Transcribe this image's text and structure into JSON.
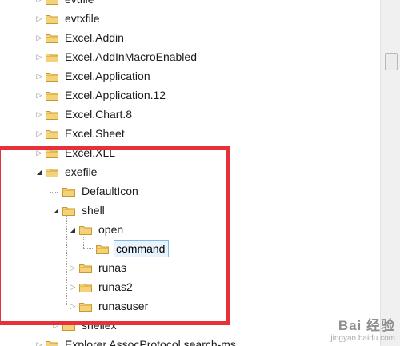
{
  "tree": {
    "items": [
      {
        "label": "evtfile",
        "expander": "collapsed",
        "depth": 0
      },
      {
        "label": "evtxfile",
        "expander": "collapsed",
        "depth": 0
      },
      {
        "label": "Excel.Addin",
        "expander": "collapsed",
        "depth": 0
      },
      {
        "label": "Excel.AddInMacroEnabled",
        "expander": "collapsed",
        "depth": 0
      },
      {
        "label": "Excel.Application",
        "expander": "collapsed",
        "depth": 0
      },
      {
        "label": "Excel.Application.12",
        "expander": "collapsed",
        "depth": 0
      },
      {
        "label": "Excel.Chart.8",
        "expander": "collapsed",
        "depth": 0
      },
      {
        "label": "Excel.Sheet",
        "expander": "collapsed",
        "depth": 0
      },
      {
        "label": "Excel.XLL",
        "expander": "collapsed",
        "depth": 0
      },
      {
        "label": "exefile",
        "expander": "expanded",
        "depth": 0
      },
      {
        "label": "DefaultIcon",
        "expander": "none",
        "depth": 1
      },
      {
        "label": "shell",
        "expander": "expanded",
        "depth": 1
      },
      {
        "label": "open",
        "expander": "expanded",
        "depth": 2
      },
      {
        "label": "command",
        "expander": "none",
        "depth": 3,
        "selected": true
      },
      {
        "label": "runas",
        "expander": "collapsed",
        "depth": 2
      },
      {
        "label": "runas2",
        "expander": "collapsed",
        "depth": 2
      },
      {
        "label": "runasuser",
        "expander": "collapsed",
        "depth": 2
      },
      {
        "label": "shellex",
        "expander": "collapsed",
        "depth": 1
      },
      {
        "label": "Explorer.AssocProtocol.search-ms",
        "expander": "collapsed",
        "depth": 0
      }
    ]
  },
  "icons": {
    "expander_collapsed": "triangle-right-icon",
    "expander_expanded": "triangle-down-icon",
    "folder": "folder-icon"
  },
  "colors": {
    "highlight_box": "#e8303a",
    "folder_fill": "#f3d27a",
    "selection_fill": "#e8f3fd",
    "selection_border": "#7fb8e8"
  },
  "watermark": {
    "logo": "Bai 经验",
    "url": "jingyan.baidu.com"
  }
}
